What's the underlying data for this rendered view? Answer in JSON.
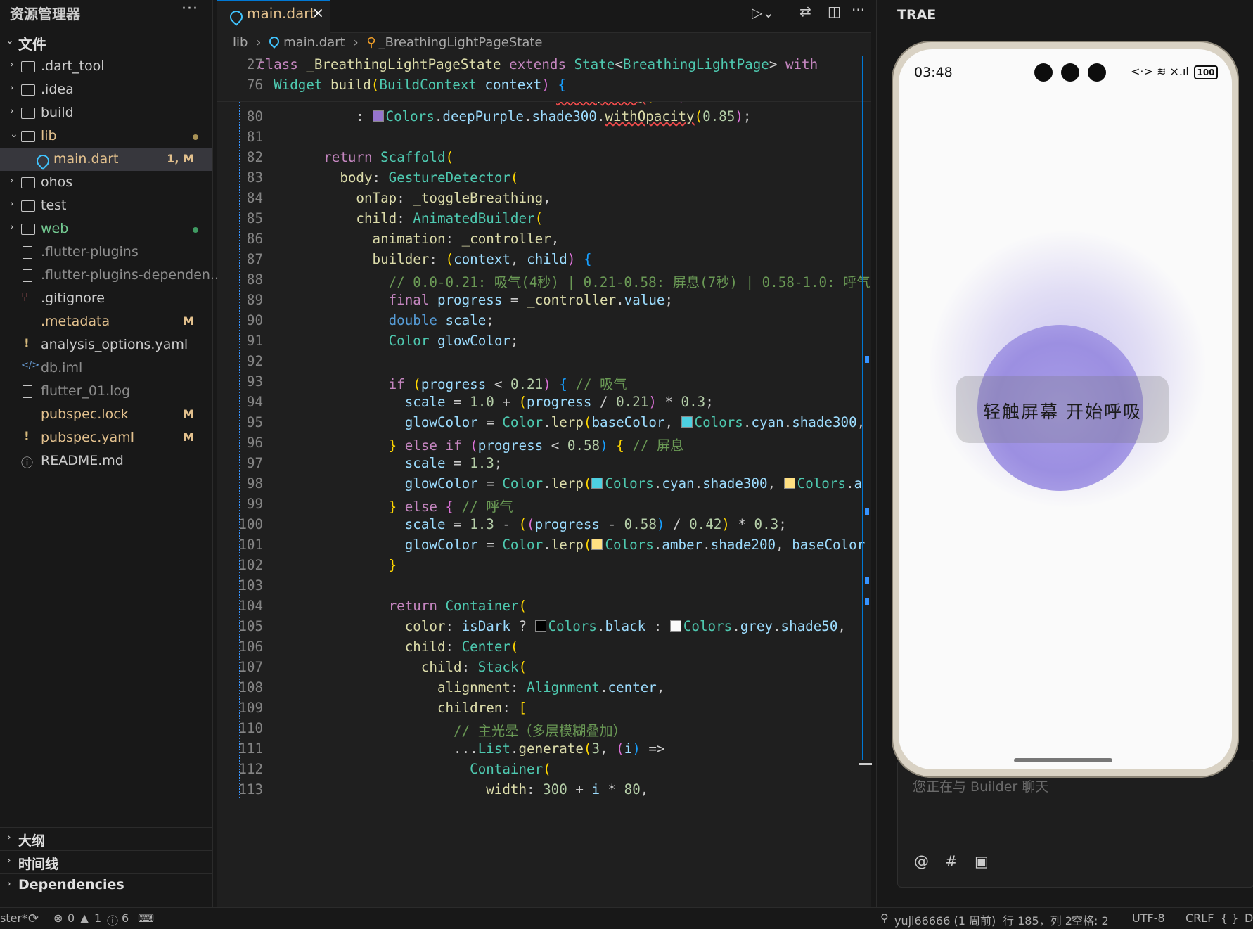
{
  "explorer": {
    "title": "资源管理器",
    "more": "···",
    "section_files": "文件",
    "tree": [
      {
        "name": ".dart_tool",
        "type": "folder",
        "color": "#cccccc"
      },
      {
        "name": ".idea",
        "type": "folder",
        "color": "#cccccc"
      },
      {
        "name": "build",
        "type": "folder",
        "color": "#cccccc"
      },
      {
        "name": "lib",
        "type": "folder-open",
        "color": "#e2c08d"
      },
      {
        "name": "main.dart",
        "type": "dart",
        "status": "1, M",
        "color": "#e2c08d"
      },
      {
        "name": "ohos",
        "type": "folder",
        "color": "#cccccc"
      },
      {
        "name": "test",
        "type": "folder",
        "color": "#cccccc"
      },
      {
        "name": "web",
        "type": "folder",
        "color": "#73c991"
      },
      {
        "name": ".flutter-plugins",
        "type": "file",
        "color": "#8c8c8c"
      },
      {
        "name": ".flutter-plugins-dependen...",
        "type": "file",
        "color": "#8c8c8c"
      },
      {
        "name": ".gitignore",
        "type": "git",
        "color": "#cccccc"
      },
      {
        "name": ".metadata",
        "type": "file",
        "status": "M",
        "color": "#e2c08d"
      },
      {
        "name": "analysis_options.yaml",
        "type": "yaml",
        "color": "#cccccc"
      },
      {
        "name": "db.iml",
        "type": "code",
        "color": "#8c8c8c"
      },
      {
        "name": "flutter_01.log",
        "type": "file",
        "color": "#8c8c8c"
      },
      {
        "name": "pubspec.lock",
        "type": "file",
        "status": "M",
        "color": "#e2c08d"
      },
      {
        "name": "pubspec.yaml",
        "type": "yaml",
        "status": "M",
        "color": "#e2c08d"
      },
      {
        "name": "README.md",
        "type": "info",
        "color": "#cccccc"
      }
    ],
    "bottom_sections": [
      "大纲",
      "时间线",
      "Dependencies"
    ]
  },
  "editor": {
    "tab_label": "main.dart",
    "tab_close": "×",
    "breadcrumb": [
      "lib",
      "main.dart",
      "_BreathingLightPageState"
    ],
    "sticky_lines": [
      {
        "n": "27",
        "code": "class _BreathingLightPageState extends State<BreathingLightPage> with"
      },
      {
        "n": "76",
        "code": "  Widget build(BuildContext context) {"
      }
    ],
    "first_line": 79,
    "lines": [
      "        ? Colors.blue.shade200.withOpacity(0.9)",
      "        : Colors.deepPurple.shade300.withOpacity(0.85);",
      "",
      "    return Scaffold(",
      "      body: GestureDetector(",
      "        onTap: _toggleBreathing,",
      "        child: AnimatedBuilder(",
      "          animation: _controller,",
      "          builder: (context, child) {",
      "            // 0.0-0.21: 吸气(4秒) | 0.21-0.58: 屏息(7秒) | 0.58-1.0: 呼气",
      "            final progress = _controller.value;",
      "            double scale;",
      "            Color glowColor;",
      "",
      "            if (progress < 0.21) { // 吸气",
      "              scale = 1.0 + (progress / 0.21) * 0.3;",
      "              glowColor = Color.lerp(baseColor, Colors.cyan.shade300,",
      "            } else if (progress < 0.58) { // 屏息",
      "              scale = 1.3;",
      "              glowColor = Color.lerp(Colors.cyan.shade300, Colors.a",
      "            } else { // 呼气",
      "              scale = 1.3 - ((progress - 0.58) / 0.42) * 0.3;",
      "              glowColor = Color.lerp(Colors.amber.shade200, baseColor",
      "            }",
      "",
      "            return Container(",
      "              color: isDark ? Colors.black : Colors.grey.shade50,",
      "              child: Center(",
      "                child: Stack(",
      "                  alignment: Alignment.center,",
      "                  children: [",
      "                    // 主光晕（多层模糊叠加）",
      "                    ...List.generate(3, (i) =>",
      "                      Container(",
      "                        width: 300 + i * 80,"
    ]
  },
  "trae": {
    "title": "TRAE",
    "chat_placeholder": "您正在与 Builder 聊天",
    "chat_icons": [
      "@",
      "#",
      "▣"
    ],
    "phone": {
      "time": "03:48",
      "status_icons": "<·> ≋ ×.ıl",
      "battery": "100",
      "toast": "轻触屏幕 开始呼吸"
    }
  },
  "statusbar": {
    "branch": "ster*",
    "errors": "0",
    "warnings": "1",
    "infos": "6",
    "author": "yuji66666 (1 周前)",
    "position": "行 185，列 2",
    "spaces": "空格: 2",
    "encoding": "UTF-8",
    "eol": "CRLF",
    "braces": "{ }",
    "tail": "D"
  }
}
